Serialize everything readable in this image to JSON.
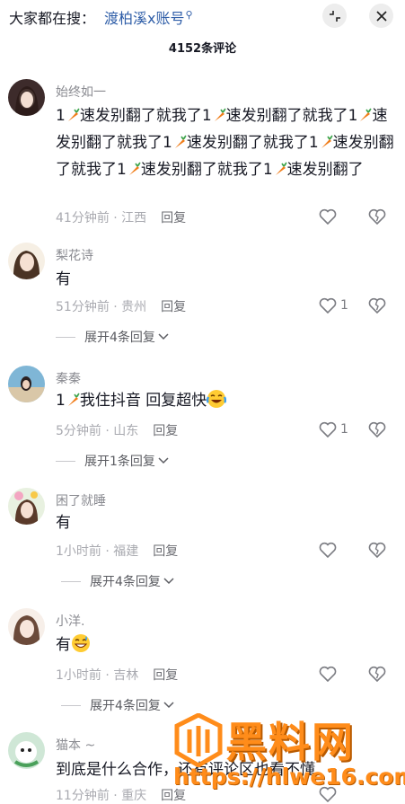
{
  "search": {
    "prefix": "大家都在搜：",
    "query": "渡柏溪x账号",
    "query_icon": "search-icon"
  },
  "header": {
    "count_label": "4152条评论",
    "collapse_icon": "collapse-icon",
    "close_icon": "close-icon"
  },
  "comments": [
    {
      "user": "始终如一",
      "text_segments": [
        "1",
        "速发别翻了就我了1",
        "速发别翻了就我了1",
        "速发别翻了就我了1",
        "速发别翻了就我了1",
        "速发别翻了就我了1",
        "速发别翻了就我了1",
        "速发别翻了"
      ],
      "time_location": "41分钟前 · 江西",
      "reply_label": "回复",
      "like_count": ""
    },
    {
      "user": "梨花诗",
      "text": "有",
      "time_location": "51分钟前 · 贵州",
      "reply_label": "回复",
      "like_count": "1",
      "expand_label": "展开4条回复"
    },
    {
      "user": "秦秦",
      "text_before": "1",
      "text_after": "我住抖音 回复超快",
      "time_location": "5分钟前 · 山东",
      "reply_label": "回复",
      "like_count": "1",
      "expand_label": "展开1条回复"
    },
    {
      "user": "困了就睡",
      "text": "有",
      "time_location": "1小时前 · 福建",
      "reply_label": "回复",
      "like_count": "",
      "expand_label": "展开4条回复"
    },
    {
      "user": "小洋.",
      "text": "有",
      "time_location": "1小时前 · 吉林",
      "reply_label": "回复",
      "like_count": "",
      "expand_label": "展开4条回复"
    },
    {
      "user": "猫本 ~",
      "text": "到底是什么合作，还有评论区也看不懂",
      "time_location": "11分钟前 · 重庆",
      "reply_label": "回复",
      "like_count": ""
    }
  ],
  "watermark": {
    "title": "黑料网",
    "url": "https://hlwe16.com"
  },
  "colors": {
    "accent_link": "#2f5ea8",
    "watermark": "#ff8c1a",
    "muted": "#a9aab0"
  }
}
